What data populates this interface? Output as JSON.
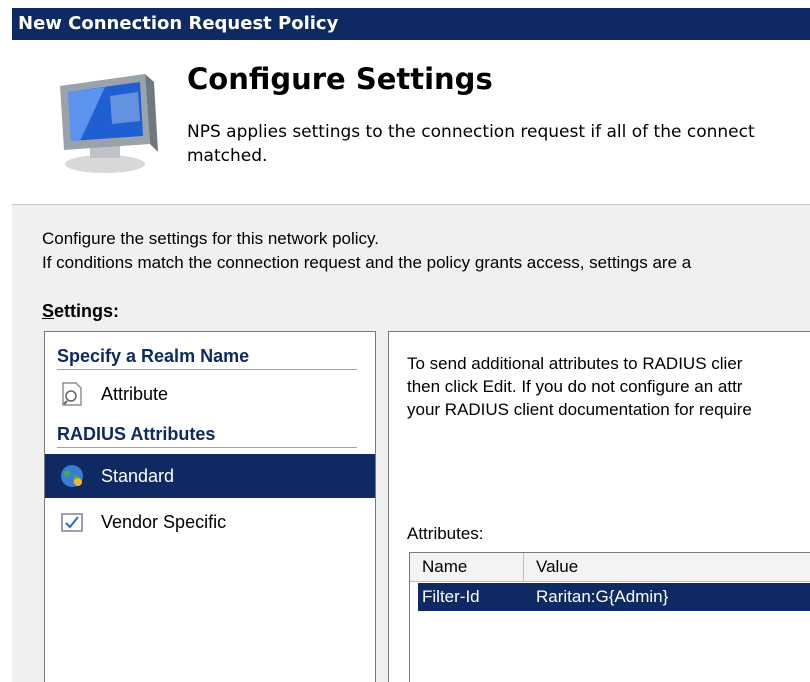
{
  "window": {
    "title": "New Connection Request Policy"
  },
  "header": {
    "title": "Configure Settings",
    "description_line1": "NPS applies settings to the connection request if all of the connect",
    "description_line2": "matched.",
    "icon": "monitor-icon"
  },
  "intro": {
    "line1": "Configure the settings for this network policy.",
    "line2": "If conditions match the connection request and the policy grants access, settings are a"
  },
  "settings": {
    "label_accel": "S",
    "label_rest": "ettings:",
    "groups": [
      {
        "header": "Specify a Realm Name",
        "items": [
          {
            "label": "Attribute",
            "icon": "attribute-icon",
            "selected": false
          }
        ]
      },
      {
        "header": "RADIUS Attributes",
        "items": [
          {
            "label": "Standard",
            "icon": "globe-icon",
            "selected": true
          },
          {
            "label": "Vendor Specific",
            "icon": "checkbox-icon",
            "selected": false
          }
        ]
      }
    ]
  },
  "right_panel": {
    "description_line1": "To send additional attributes to RADIUS clier",
    "description_line2": "then click Edit. If you do not configure an attr",
    "description_line3": "your RADIUS client documentation for require",
    "attributes_label": "Attributes:",
    "table": {
      "columns": [
        "Name",
        "Value"
      ],
      "rows": [
        {
          "name": "Filter-Id",
          "value": "Raritan:G{Admin}",
          "selected": true
        }
      ]
    }
  },
  "colors": {
    "accent": "#0f2a62",
    "panel_bg": "#f0f0f0"
  }
}
